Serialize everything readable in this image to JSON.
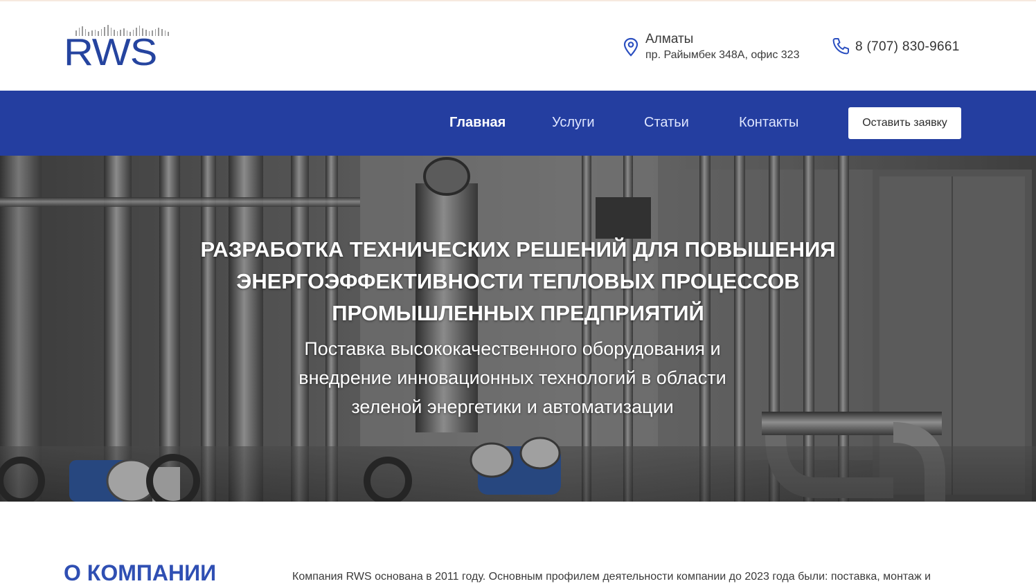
{
  "brand": {
    "logo_text": "RWS",
    "color": "#25449f"
  },
  "header": {
    "city": "Алматы",
    "address": "пр. Райымбек 348А, офис 323",
    "phone": "8 (707) 830-9661",
    "icons": [
      "map-pin-icon",
      "phone-icon"
    ]
  },
  "nav": {
    "items": [
      {
        "label": "Главная",
        "active": true
      },
      {
        "label": "Услуги",
        "active": false
      },
      {
        "label": "Статьи",
        "active": false
      },
      {
        "label": "Контакты",
        "active": false
      }
    ],
    "cta_label": "Оставить заявку",
    "background": "#243ea0"
  },
  "hero": {
    "title": "РАЗРАБОТКА ТЕХНИЧЕСКИХ РЕШЕНИЙ ДЛЯ ПОВЫШЕНИЯ ЭНЕРГОЭФФЕКТИВНОСТИ ТЕПЛОВЫХ ПРОЦЕССОВ ПРОМЫШЛЕННЫХ ПРЕДПРИЯТИЙ",
    "subtitle": "Поставка высококачественного оборудования и внедрение инновационных технологий в области зеленой энергетики и автоматизации"
  },
  "about": {
    "heading": "О КОМПАНИИ",
    "text": "Компания RWS основана в 2011 году. Основным профилем деятельности компании до 2023 года были: поставка, монтаж и"
  }
}
